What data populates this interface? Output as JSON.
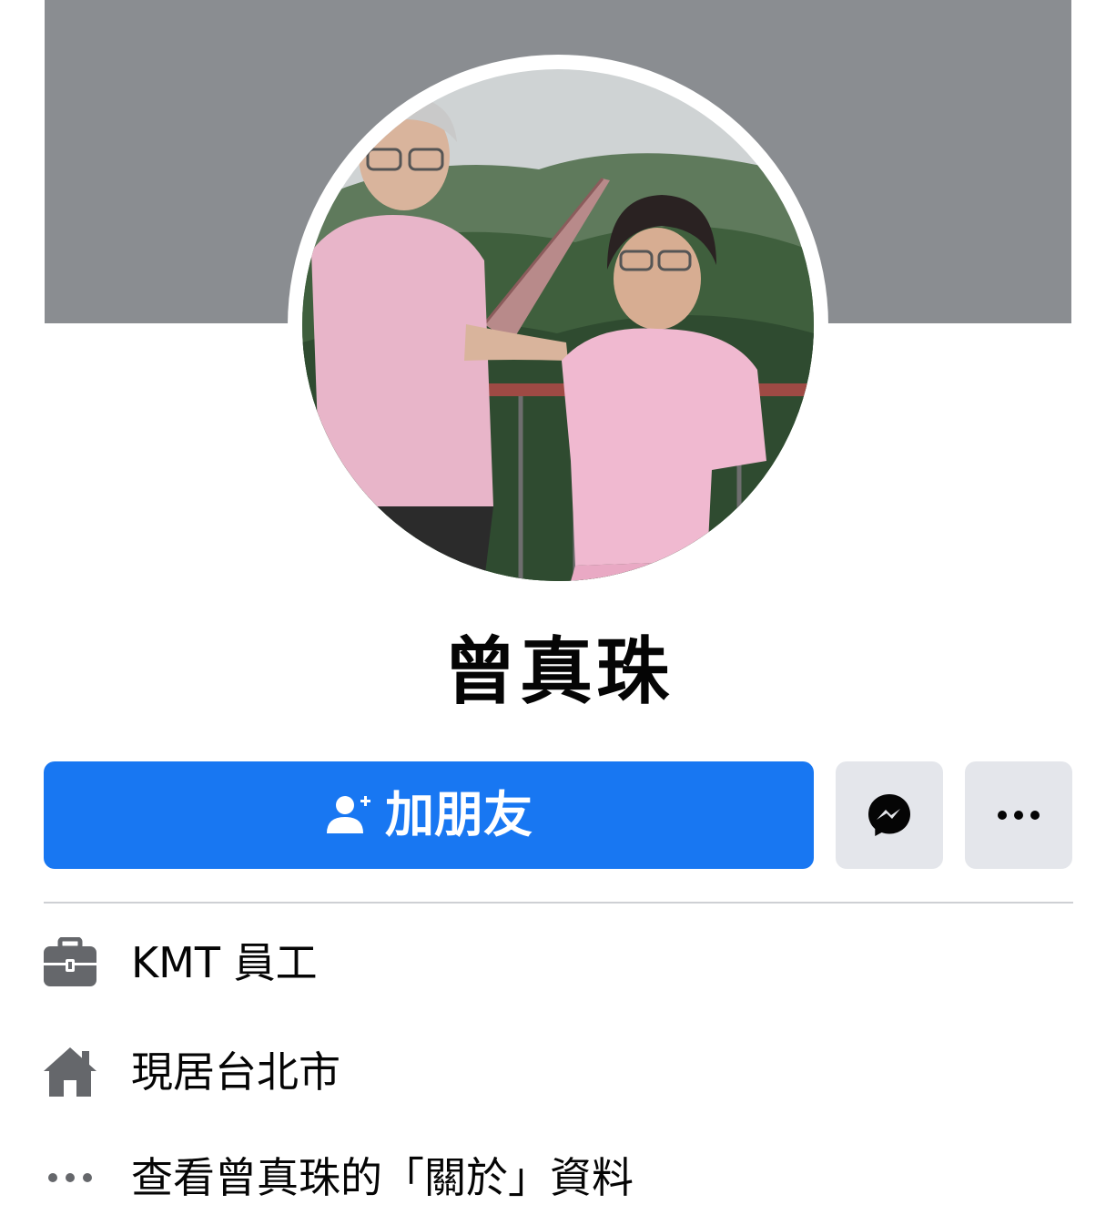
{
  "profile": {
    "name": "曾真珠"
  },
  "actions": {
    "add_friend_label": "加朋友"
  },
  "colors": {
    "primary": "#1877f2",
    "secondary_button": "#e4e6eb",
    "cover": "#8a8d91",
    "icon_gray": "#65676b"
  },
  "info": [
    {
      "icon": "briefcase-icon",
      "text": "KMT 員工"
    },
    {
      "icon": "home-icon",
      "text": "現居台北市"
    },
    {
      "icon": "more-dots-icon",
      "text": "查看曾真珠的「關於」資料"
    }
  ]
}
